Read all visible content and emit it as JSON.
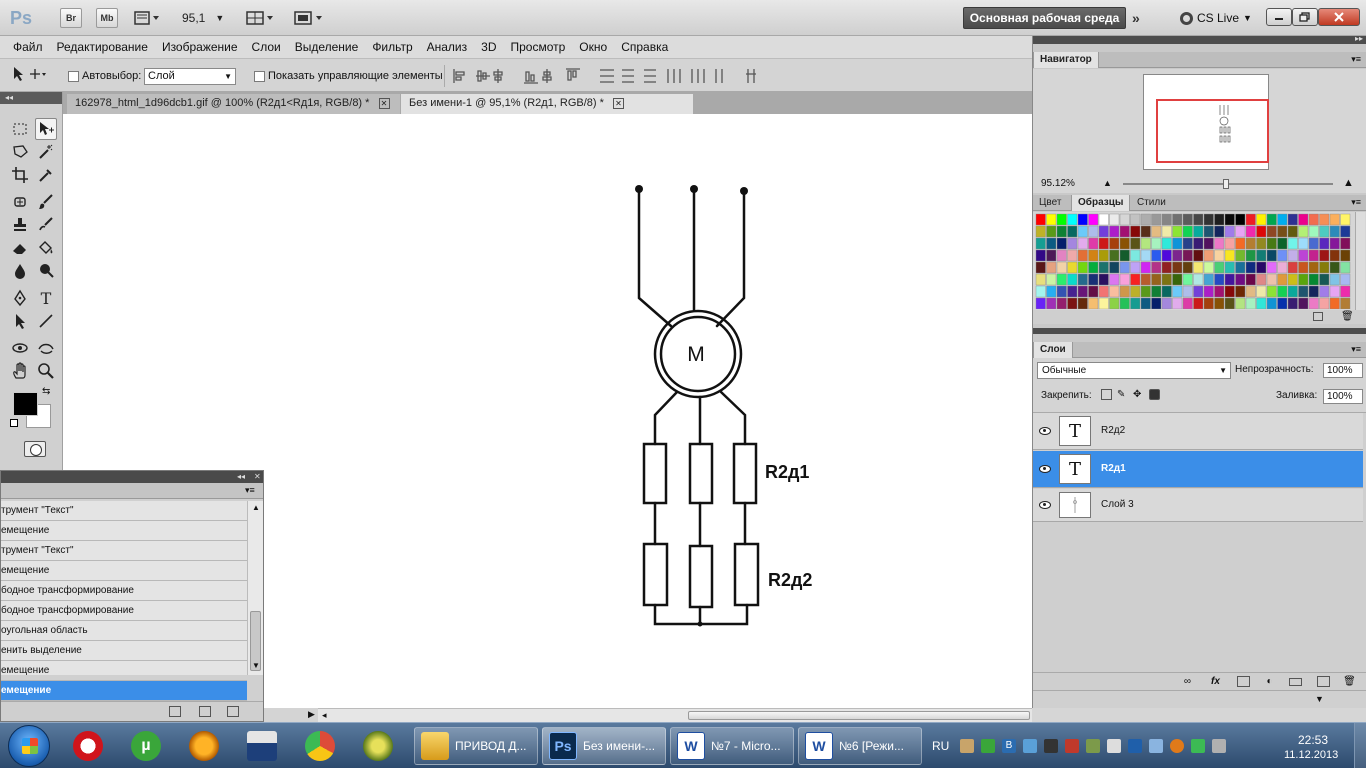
{
  "app_bar": {
    "logo": "Ps",
    "bridge": "Br",
    "minibridge": "Mb",
    "zoom": "95,1",
    "workspace": "Основная рабочая среда",
    "cs_live": "CS Live"
  },
  "menu": [
    "Файл",
    "Редактирование",
    "Изображение",
    "Слои",
    "Выделение",
    "Фильтр",
    "Анализ",
    "3D",
    "Просмотр",
    "Окно",
    "Справка"
  ],
  "options": {
    "autoselect_label": "Автовыбор:",
    "autoselect_value": "Слой",
    "show_controls_label": "Показать управляющие элементы"
  },
  "doc_tabs": [
    {
      "label": "162978_html_1d96dcb1.gif @ 100% (R2д1<Rд1я, RGB/8) *"
    },
    {
      "label": "Без имени-1 @ 95,1% (R2д1, RGB/8) *"
    }
  ],
  "canvas": {
    "motor_label": "M",
    "resistor_1_label": "R2д1",
    "resistor_2_label": "R2д2"
  },
  "history": {
    "items": [
      "трумент \"Текст\"",
      "емещение",
      "трумент \"Текст\"",
      "емещение",
      "бодное трансформирование",
      "бодное трансформирование",
      "оугольная область",
      "енить выделение",
      "емещение",
      "емещение"
    ]
  },
  "navigator": {
    "tab": "Навигатор",
    "zoom": "95.12%"
  },
  "swatches_panel": {
    "tabs": [
      "Цвет",
      "Образцы",
      "Стили"
    ]
  },
  "layers_panel": {
    "tab": "Слои",
    "blend_mode": "Обычные",
    "opacity_label": "Непрозрачность:",
    "opacity": "100%",
    "lock_label": "Закрепить:",
    "fill_label": "Заливка:",
    "fill": "100%",
    "layers": [
      {
        "name": "R2д2",
        "thumb": "T"
      },
      {
        "name": "R2д1",
        "thumb": "T"
      },
      {
        "name": "Слой 3",
        "thumb": ""
      }
    ]
  },
  "taskbar": {
    "tasks": [
      {
        "label": "ПРИВОД Д..."
      },
      {
        "label": "Без имени-..."
      },
      {
        "label": "№7 - Micro..."
      },
      {
        "label": "№6 [Режи..."
      }
    ],
    "lang": "RU",
    "time": "22:53",
    "date": "11.12.2013"
  }
}
